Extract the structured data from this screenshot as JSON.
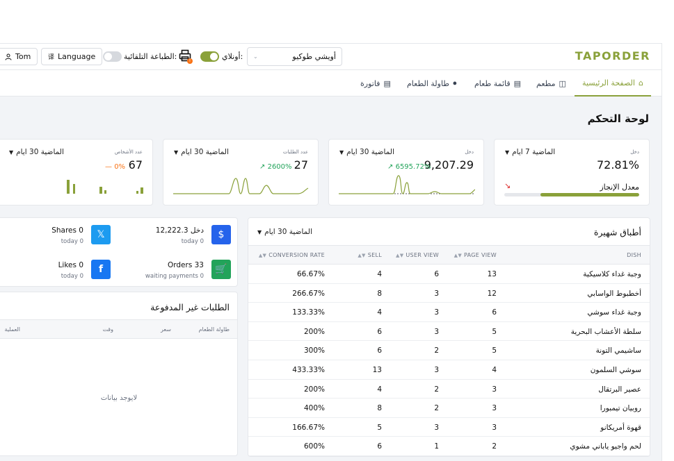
{
  "header": {
    "logo": "TAPORDER",
    "branch_select": "أويشي طوكيو",
    "online_label": "أونلاي:",
    "auto_print_label": "الطباعة التلقائية:",
    "print_badge": "!",
    "language_label": "Language",
    "user_label": "Tom"
  },
  "nav": {
    "items": [
      {
        "label": "الصفحة الرئيسية",
        "icon": "home-icon",
        "active": true
      },
      {
        "label": "مطعم",
        "icon": "store-icon"
      },
      {
        "label": "قائمة طعام",
        "icon": "menu-icon"
      },
      {
        "label": "طاولة الطعام",
        "icon": "utensils-icon"
      },
      {
        "label": "فاتورة",
        "icon": "receipt-icon"
      }
    ]
  },
  "page_title": "لوحة التحكم",
  "stats": {
    "goal": {
      "caption": "دخل",
      "period": "الماضية 7 ايام",
      "value": "72.81%",
      "label": "معدل الإنجاز",
      "progress": 0.73
    },
    "income": {
      "caption": "دخل",
      "period": "الماضية 30 ايام",
      "value": "9,207.29",
      "pct": "6595.72%"
    },
    "orders": {
      "caption": "عدد الطلبات",
      "period": "الماضية 30 ايام",
      "value": "27",
      "pct": "2600%"
    },
    "people": {
      "caption": "عدد الأشخاص",
      "period": "الماضية 30 ايام",
      "value": "67",
      "pct": "0%"
    }
  },
  "social": {
    "income": {
      "title": "12,222.3 دخل",
      "sub": "today 0"
    },
    "shares": {
      "title": "Shares 0",
      "sub": "today 0"
    },
    "orders": {
      "title": "Orders 33",
      "sub": "waiting payments 0"
    },
    "likes": {
      "title": "Likes 0",
      "sub": "today 0"
    }
  },
  "unpaid": {
    "title": "الطلبات غير المدفوعة",
    "columns": [
      "طاولة الطعام",
      "سعر",
      "وقت",
      "العملية"
    ],
    "empty_text": "لايوجد بيانات"
  },
  "popular": {
    "title": "أطباق شهيرة",
    "period": "الماضية 30 ايام",
    "columns": [
      "DISH",
      "PAGE VIEW",
      "USER VIEW",
      "SELL",
      "CONVERSION RATE"
    ],
    "rows": [
      {
        "dish": "وجبة غداء كلاسيكية",
        "page_view": "13",
        "user_view": "6",
        "sell": "4",
        "rate": "66.67%"
      },
      {
        "dish": "أخطبوط الواسابي",
        "page_view": "12",
        "user_view": "3",
        "sell": "8",
        "rate": "266.67%"
      },
      {
        "dish": "وجبة غداء سوشي",
        "page_view": "6",
        "user_view": "3",
        "sell": "4",
        "rate": "133.33%"
      },
      {
        "dish": "سلطة الأعشاب البحرية",
        "page_view": "5",
        "user_view": "3",
        "sell": "6",
        "rate": "200%"
      },
      {
        "dish": "ساشيمي التونة",
        "page_view": "5",
        "user_view": "2",
        "sell": "6",
        "rate": "300%"
      },
      {
        "dish": "سوشي السلمون",
        "page_view": "4",
        "user_view": "3",
        "sell": "13",
        "rate": "433.33%"
      },
      {
        "dish": "عصير البرتقال",
        "page_view": "3",
        "user_view": "2",
        "sell": "4",
        "rate": "200%"
      },
      {
        "dish": "روبيان تيمبورا",
        "page_view": "3",
        "user_view": "2",
        "sell": "8",
        "rate": "400%"
      },
      {
        "dish": "قهوة أمريكانو",
        "page_view": "3",
        "user_view": "3",
        "sell": "5",
        "rate": "166.67%"
      },
      {
        "dish": "لحم واجيو ياباني مشوي",
        "page_view": "2",
        "user_view": "1",
        "sell": "6",
        "rate": "600%"
      }
    ]
  },
  "colors": {
    "brand": "#8aa13a",
    "up": "#22a35a",
    "down": "#f97316",
    "twitter": "#1d9bf0",
    "facebook": "#1877f2",
    "dollar": "#2563eb",
    "cart": "#22a35a"
  }
}
